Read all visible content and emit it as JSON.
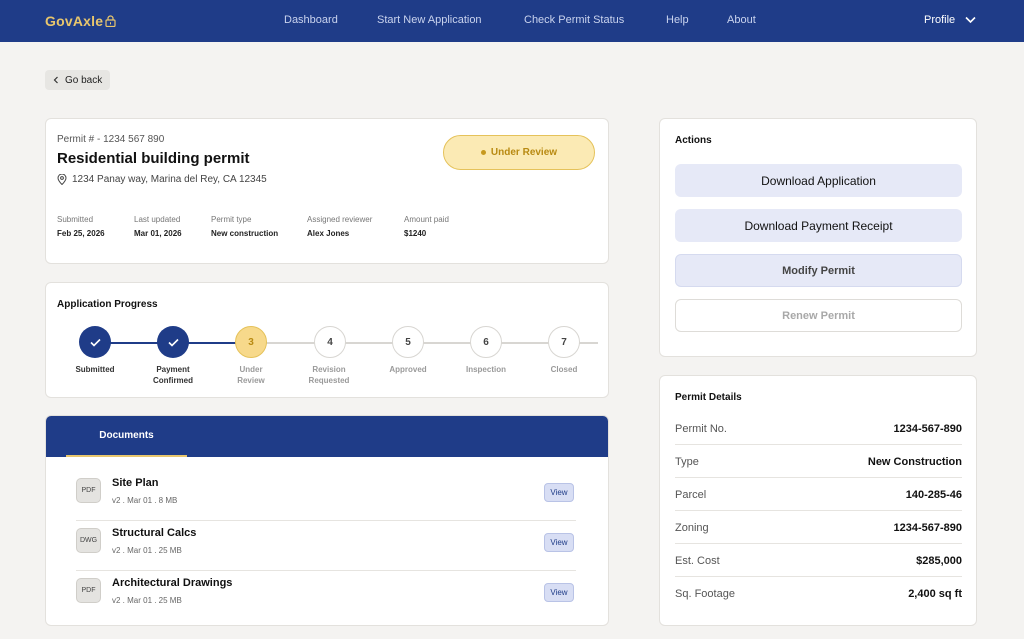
{
  "nav": {
    "logo": "GovAxle",
    "links": [
      "Dashboard",
      "Start New Application",
      "Check Permit Status",
      "Help",
      "About"
    ],
    "profile": "Profile"
  },
  "go_back": "Go back",
  "permit": {
    "number": "Permit # - 1234 567 890",
    "title": "Residential building permit",
    "address": "1234 Panay way, Marina del Rey, CA 12345",
    "status": "Under Review",
    "meta": [
      {
        "label": "Submitted",
        "value": "Feb 25, 2026"
      },
      {
        "label": "Last updated",
        "value": "Mar 01, 2026"
      },
      {
        "label": "Permit type",
        "value": "New construction"
      },
      {
        "label": "Assigned reviewer",
        "value": "Alex Jones"
      },
      {
        "label": "Amount paid",
        "value": "$1240"
      }
    ]
  },
  "progress": {
    "title": "Application Progress",
    "steps": [
      {
        "number": "1",
        "label": "Submitted",
        "state": "done"
      },
      {
        "number": "2",
        "label": "Payment\nConfirmed",
        "state": "done"
      },
      {
        "number": "3",
        "label": "Under\nReview",
        "state": "current"
      },
      {
        "number": "4",
        "label": "Revision\nRequested",
        "state": "todo"
      },
      {
        "number": "5",
        "label": "Approved",
        "state": "todo"
      },
      {
        "number": "6",
        "label": "Inspection",
        "state": "todo"
      },
      {
        "number": "7",
        "label": "Closed",
        "state": "todo"
      }
    ]
  },
  "documents": {
    "tab": "Documents",
    "view_label": "View",
    "items": [
      {
        "type": "PDF",
        "name": "Site Plan",
        "meta": "v2 . Mar 01 . 8 MB"
      },
      {
        "type": "DWG",
        "name": "Structural Calcs",
        "meta": "v2 . Mar 01 . 25 MB"
      },
      {
        "type": "PDF",
        "name": "Architectural Drawings",
        "meta": "v2 . Mar 01 . 25 MB"
      }
    ]
  },
  "actions": {
    "title": "Actions",
    "download_application": "Download Application",
    "download_receipt": "Download Payment Receipt",
    "modify": "Modify Permit",
    "renew": "Renew Permit"
  },
  "details": {
    "title": "Permit Details",
    "rows": [
      {
        "label": "Permit No.",
        "value": "1234-567-890"
      },
      {
        "label": "Type",
        "value": "New Construction"
      },
      {
        "label": "Parcel",
        "value": "140-285-46"
      },
      {
        "label": "Zoning",
        "value": "1234-567-890"
      },
      {
        "label": "Est. Cost",
        "value": "$285,000"
      },
      {
        "label": "Sq. Footage",
        "value": "2,400 sq ft"
      }
    ]
  }
}
